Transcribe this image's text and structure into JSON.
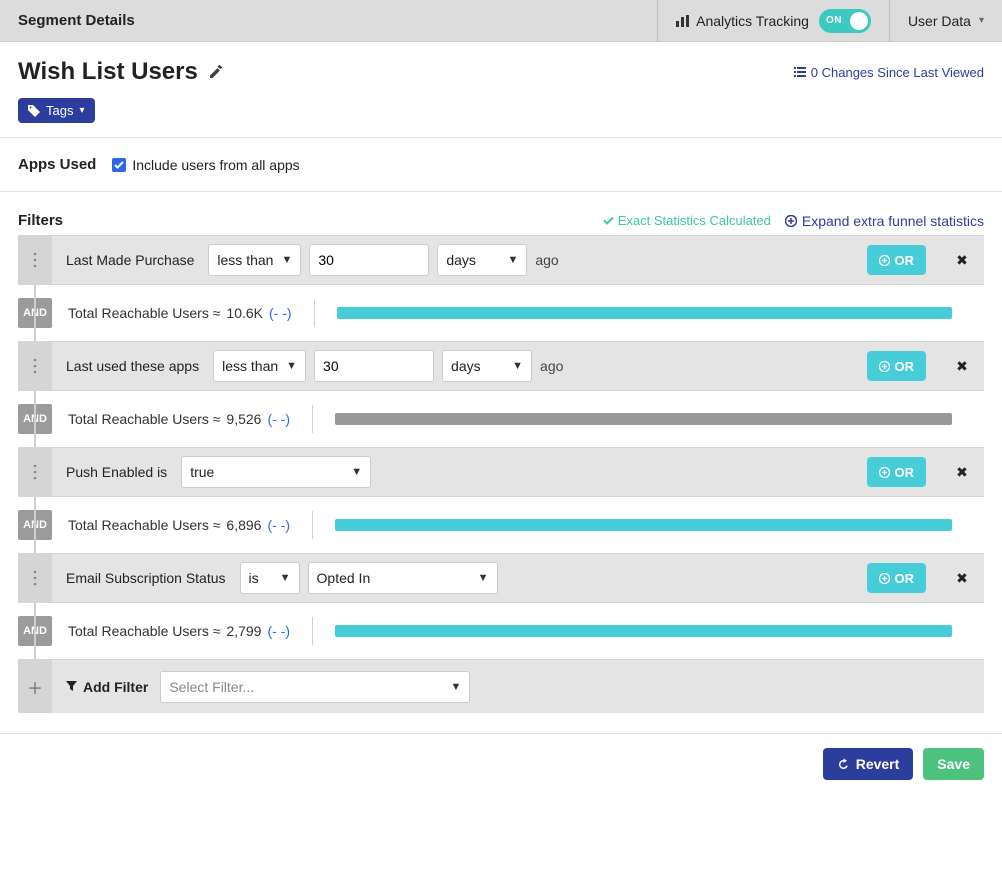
{
  "header": {
    "title": "Segment Details",
    "analytics_label": "Analytics Tracking",
    "toggle_text": "ON",
    "user_data_label": "User Data"
  },
  "segment": {
    "name": "Wish List Users",
    "changes_link": "0 Changes Since Last Viewed",
    "tags_btn": "Tags"
  },
  "apps": {
    "section": "Apps Used",
    "checkbox_label": "Include users from all apps"
  },
  "filters_section": {
    "title": "Filters",
    "exact_stats": "Exact Statistics Calculated",
    "expand": "Expand extra funnel statistics"
  },
  "filters": [
    {
      "label": "Last Made Purchase",
      "op": "less than",
      "value": "30",
      "unit": "days",
      "suffix": "ago",
      "stat_label": "Total Reachable Users ≈",
      "stat_value": "10.6K",
      "stat_extra": "(- -)",
      "bar_pct": 100,
      "bar_grey": false
    },
    {
      "label": "Last used these apps",
      "op": "less than",
      "value": "30",
      "unit": "days",
      "suffix": "ago",
      "stat_label": "Total Reachable Users ≈",
      "stat_value": "9,526",
      "stat_extra": "(- -)",
      "bar_pct": 100,
      "bar_grey": true
    },
    {
      "label": "Push Enabled is",
      "select_value": "true",
      "stat_label": "Total Reachable Users ≈",
      "stat_value": "6,896",
      "stat_extra": "(- -)",
      "bar_pct": 100,
      "bar_grey": false
    },
    {
      "label": "Email Subscription Status",
      "op": "is",
      "select_value": "Opted In",
      "stat_label": "Total Reachable Users ≈",
      "stat_value": "2,799",
      "stat_extra": "(- -)",
      "bar_pct": 100,
      "bar_grey": false
    }
  ],
  "common": {
    "or": "OR",
    "and": "AND",
    "add_filter": "Add Filter",
    "select_placeholder": "Select Filter..."
  },
  "footer": {
    "revert": "Revert",
    "save": "Save"
  }
}
